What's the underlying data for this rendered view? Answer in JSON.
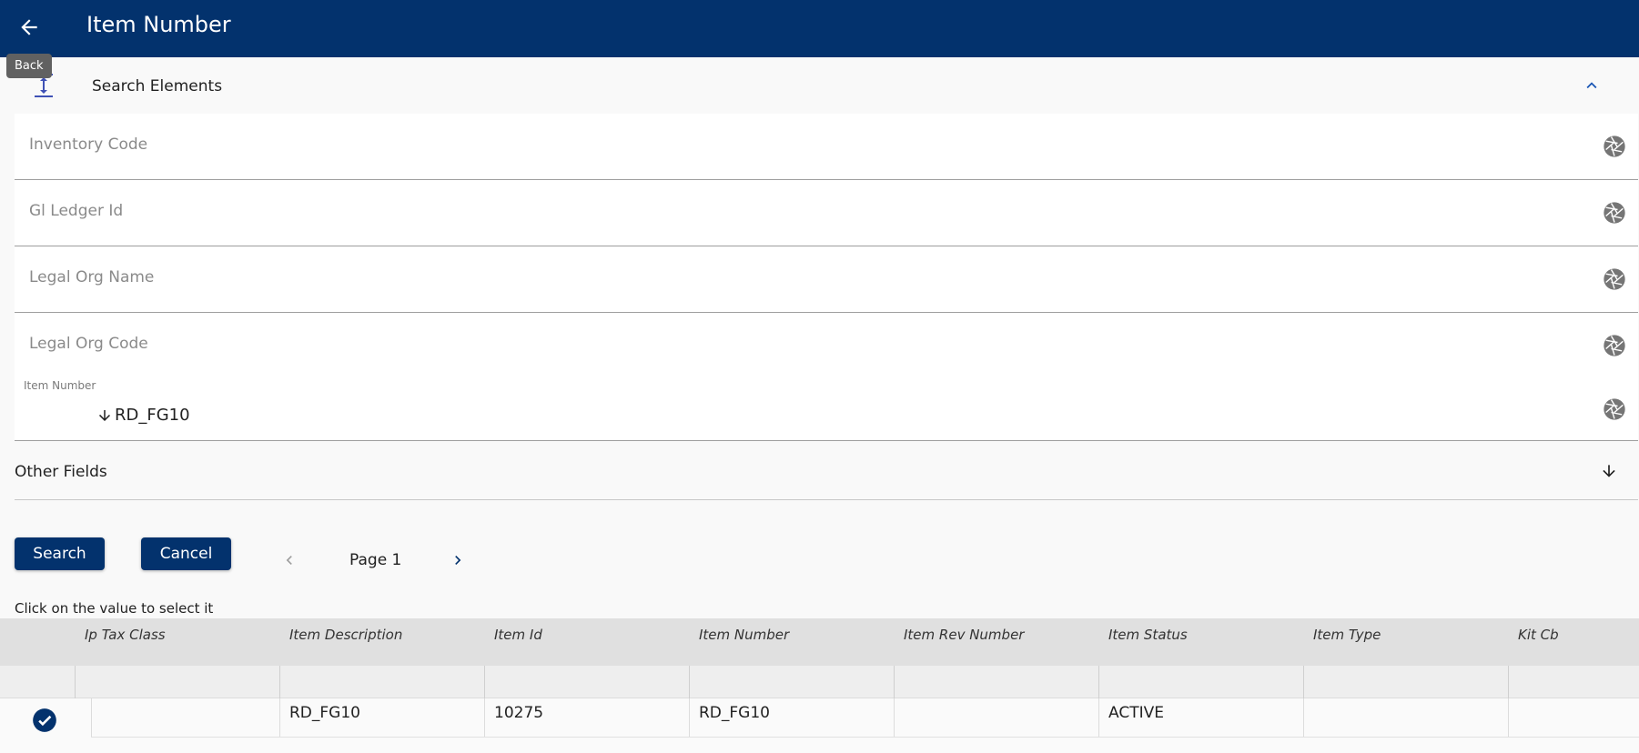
{
  "header": {
    "title": "Item Number",
    "back_tooltip": "Back"
  },
  "search": {
    "section_label": "Search Elements",
    "fields": [
      {
        "placeholder": "Inventory Code"
      },
      {
        "placeholder": "Gl Ledger Id"
      },
      {
        "placeholder": "Legal Org Name"
      },
      {
        "placeholder": "Legal Org Code"
      }
    ],
    "item_number": {
      "label": "Item Number",
      "value": "RD_FG10"
    },
    "other_fields_label": "Other Fields"
  },
  "actions": {
    "search_label": "Search",
    "cancel_label": "Cancel",
    "page_label": "Page 1"
  },
  "hint": "Click on the value to select it",
  "table": {
    "columns": [
      "Ip Tax Class",
      "Item Description",
      "Item Id",
      "Item Number",
      "Item Rev Number",
      "Item Status",
      "Item Type",
      "Kit Cb"
    ],
    "rows": [
      {
        "ip_tax_class": "",
        "item_description": "RD_FG10",
        "item_id": "10275",
        "item_number": "RD_FG10",
        "item_rev_number": "",
        "item_status": "ACTIVE",
        "item_type": "",
        "kit_cb": ""
      }
    ]
  },
  "colors": {
    "primary": "#03326d",
    "background": "#f9f9f9",
    "icon_gray": "#757575",
    "accent_blue": "#1a56b4"
  }
}
